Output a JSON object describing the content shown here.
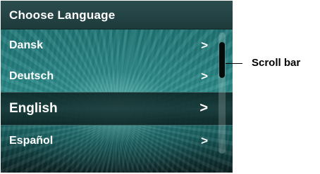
{
  "screen": {
    "title": "Choose Language",
    "languages": [
      {
        "label": "Dansk",
        "chevron": ">"
      },
      {
        "label": "Deutsch",
        "chevron": ">"
      },
      {
        "label": "English",
        "chevron": ">",
        "selected": true
      },
      {
        "label": "Español",
        "chevron": ">"
      }
    ]
  },
  "annotation": {
    "label": "Scroll bar"
  },
  "colors": {
    "background_teal": "#247f7f",
    "titlebar": "#1e3a3b",
    "text": "#ffffff",
    "scroll_thumb": "#050b0b"
  },
  "icons": {
    "chevron": "chevron-right-icon"
  }
}
